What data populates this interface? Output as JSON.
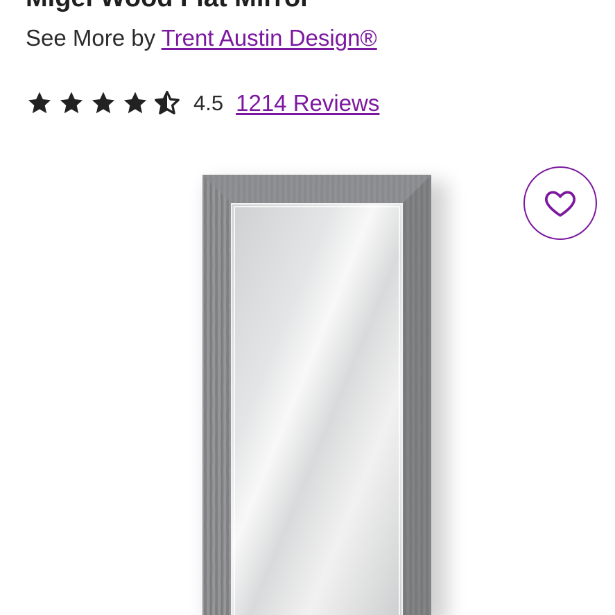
{
  "product": {
    "title": "Migel Wood Flat Mirror",
    "see_more_prefix": "See More by",
    "brand_name": "Trent Austin Design®",
    "rating_value": "4.5",
    "rating": 4.5,
    "rating_max": 5,
    "reviews_label": "1214 Reviews",
    "image_alt": "Gray wood framed rectangular mirror"
  },
  "icons": {
    "star": "star-icon",
    "half_star": "half-star-icon",
    "favorite": "heart-icon"
  },
  "colors": {
    "accent": "#7b189f",
    "text": "#2b2b2b",
    "star": "#222222",
    "frame": "#8a8b8d"
  }
}
